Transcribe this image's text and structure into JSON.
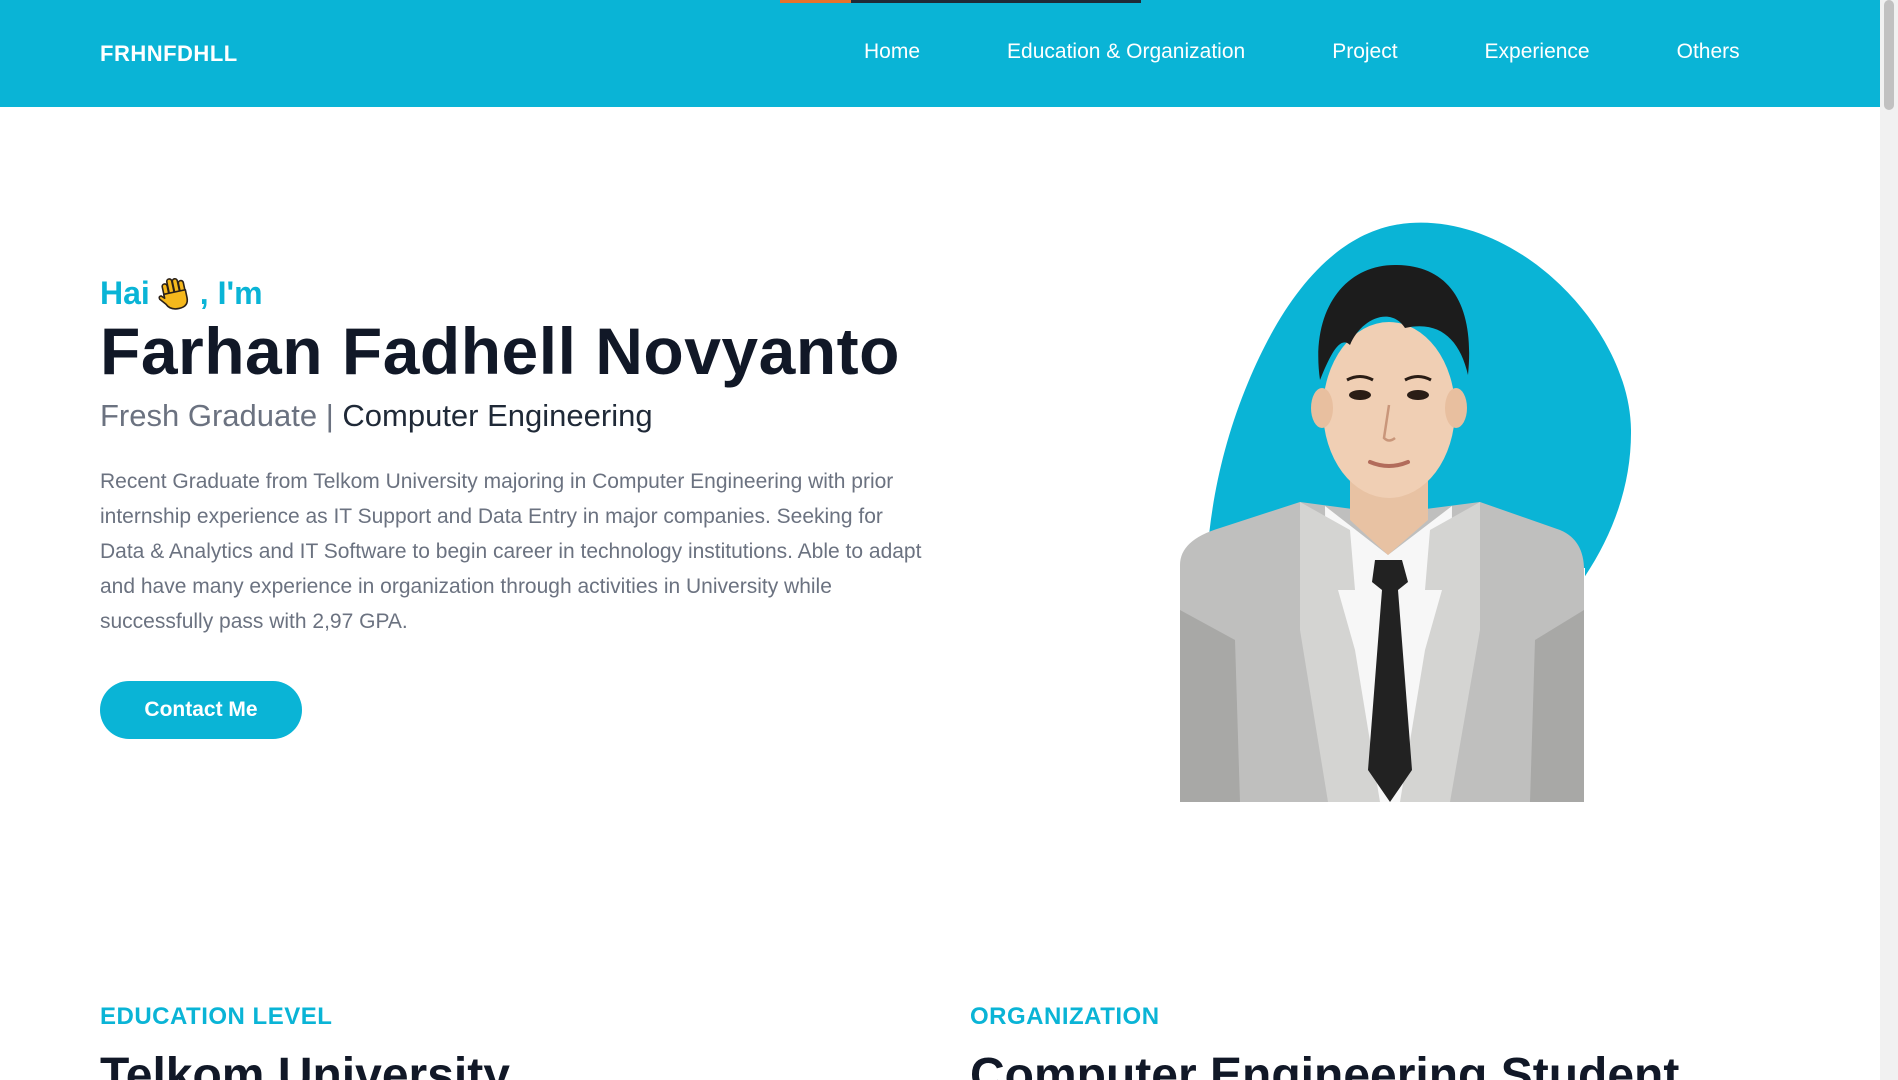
{
  "brand": "FRHNFDHLL",
  "nav": {
    "items": [
      {
        "label": "Home"
      },
      {
        "label": "Education & Organization"
      },
      {
        "label": "Project"
      },
      {
        "label": "Experience"
      },
      {
        "label": "Others"
      }
    ]
  },
  "hero": {
    "greeting_prefix": "Hai",
    "greeting_suffix": ", I'm",
    "name": "Farhan Fadhell Novyanto",
    "subtitle_part1": "Fresh Graduate | ",
    "subtitle_part2": "Computer Engineering",
    "description": "Recent Graduate from Telkom University majoring in Computer Engineering with prior internship experience as IT Support and Data Entry in major companies. Seeking for Data & Analytics and IT Software to begin career in technology institutions. Able to adapt and have many experience in organization through activities in University while successfully pass with 2,97 GPA.",
    "contact_label": "Contact Me"
  },
  "sections": {
    "education": {
      "label": "EDUCATION LEVEL",
      "heading": "Telkom University"
    },
    "organization": {
      "label": "ORGANIZATION",
      "heading": "Computer Engineering Student"
    }
  },
  "icons": {
    "wave": "waving-hand-icon"
  },
  "colors": {
    "accent": "#0ab4d6",
    "heading": "#111827",
    "muted": "#6b7280",
    "progress_active": "#e8722c"
  }
}
